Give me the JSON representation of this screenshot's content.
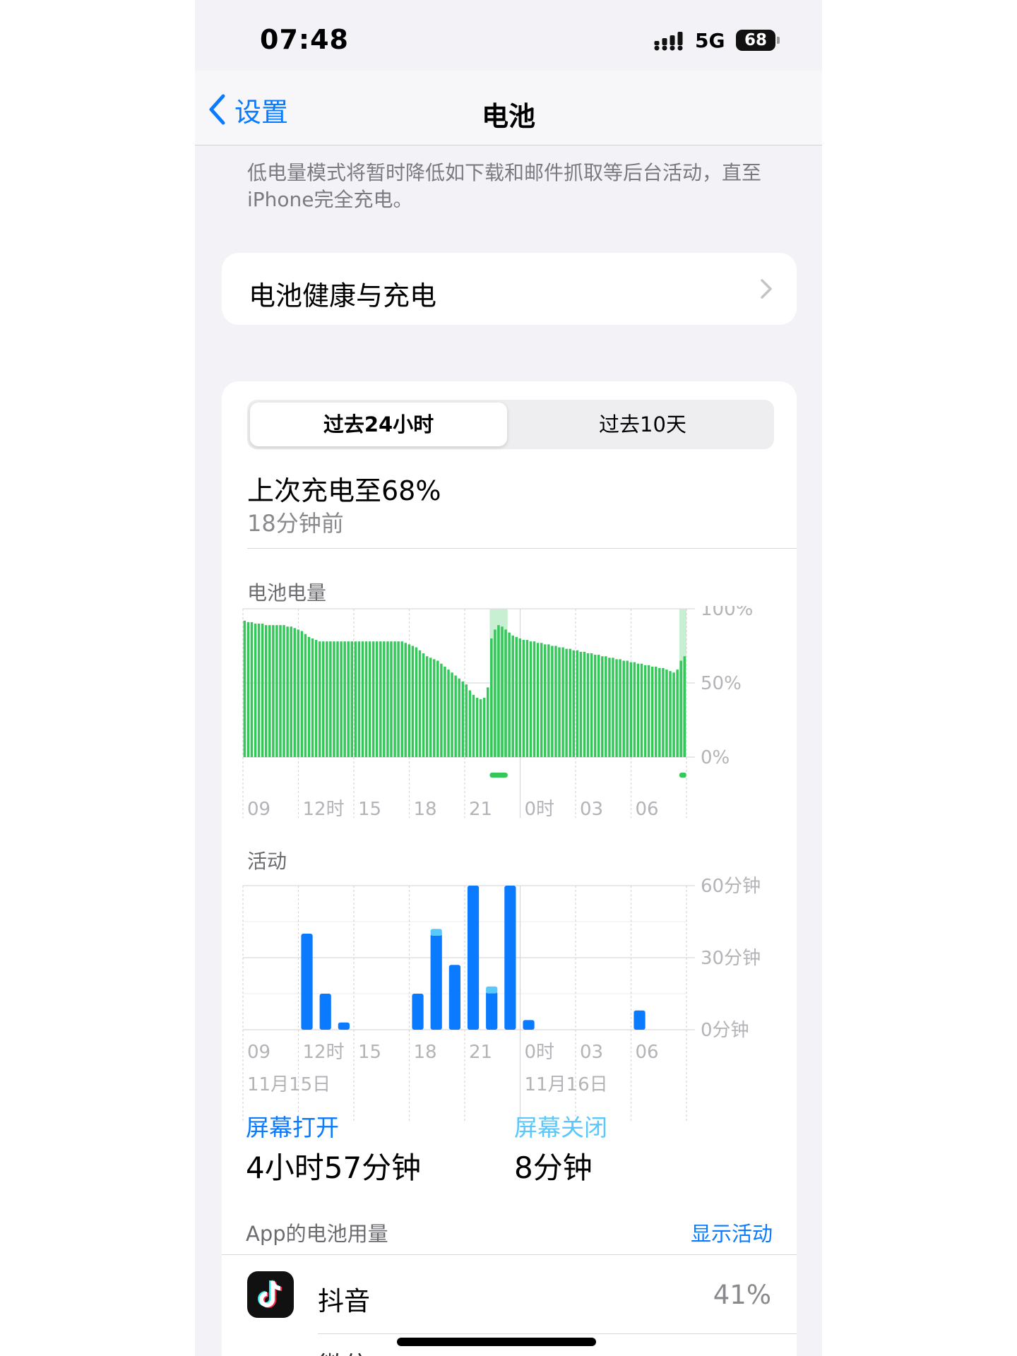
{
  "status_bar": {
    "time": "07:48",
    "network": "5G",
    "battery_level": "68"
  },
  "nav": {
    "back_label": "设置",
    "title": "电池"
  },
  "low_power_note": "低电量模式将暂时降低如下载和邮件抓取等后台活动，直至iPhone完全充电。",
  "health_row": {
    "label": "电池健康与充电"
  },
  "segmented": {
    "options": [
      "过去24小时",
      "过去10天"
    ],
    "selected": "过去24小时"
  },
  "last_charge": {
    "title": "上次充电至68%",
    "time": "18分钟前"
  },
  "colors": {
    "battery_bar": "#34c759",
    "charging_band": "#c9efd2",
    "screen_on": "#0a7aff",
    "screen_off": "#5ac8fa",
    "accent": "#0a7aff"
  },
  "chart_data": [
    {
      "type": "bar",
      "title": "电池电量",
      "x_tick_labels": [
        "09",
        "12时",
        "15",
        "18",
        "21",
        "0时",
        "03",
        "06"
      ],
      "y_tick_labels": [
        "100%",
        "50%",
        "0%"
      ],
      "ylim": [
        0,
        100
      ],
      "unit": "%",
      "values": [
        92,
        91,
        91,
        90,
        90,
        90,
        89,
        89,
        89,
        89,
        89,
        89,
        88,
        88,
        87,
        86,
        85,
        83,
        81,
        80,
        79,
        78,
        78,
        78,
        78,
        78,
        78,
        78,
        78,
        78,
        78,
        78,
        78,
        78,
        78,
        78,
        78,
        78,
        78,
        78,
        78,
        78,
        78,
        78,
        78,
        77,
        76,
        75,
        74,
        72,
        70,
        68,
        67,
        66,
        65,
        63,
        61,
        59,
        57,
        55,
        53,
        51,
        49,
        45,
        42,
        40,
        39,
        40,
        47,
        80,
        86,
        89,
        88,
        86,
        84,
        82,
        81,
        80,
        79,
        79,
        78,
        78,
        77,
        77,
        76,
        76,
        75,
        75,
        74,
        74,
        73,
        73,
        72,
        72,
        71,
        71,
        70,
        70,
        69,
        69,
        68,
        68,
        67,
        67,
        66,
        66,
        65,
        65,
        64,
        64,
        63,
        63,
        62,
        62,
        61,
        61,
        60,
        60,
        59,
        58,
        57,
        59,
        65,
        68
      ],
      "charging_periods": [
        [
          69,
          74
        ],
        [
          122,
          124
        ]
      ]
    },
    {
      "type": "bar",
      "title": "活动",
      "x_tick_labels": [
        "09",
        "12时",
        "15",
        "18",
        "21",
        "0时",
        "03",
        "06"
      ],
      "date_labels": [
        "11月15日",
        "11月16日"
      ],
      "y_tick_labels": [
        "60分钟",
        "30分钟",
        "0分钟"
      ],
      "ylim": [
        0,
        60
      ],
      "unit": "分钟",
      "categories": [
        "09",
        "10",
        "11",
        "12",
        "13",
        "14",
        "15",
        "16",
        "17",
        "18",
        "19",
        "20",
        "21",
        "22",
        "23",
        "00",
        "01",
        "02",
        "03",
        "04",
        "05",
        "06",
        "07"
      ],
      "series": [
        {
          "name": "屏幕打开",
          "values": [
            0,
            0,
            0,
            40,
            15,
            3,
            0,
            0,
            0,
            15,
            40,
            27,
            60,
            16,
            60,
            4,
            0,
            0,
            0,
            0,
            0,
            8,
            0
          ]
        },
        {
          "name": "屏幕关闭",
          "values": [
            0,
            0,
            0,
            0,
            0,
            0,
            0,
            0,
            0,
            0,
            2,
            0,
            0,
            2,
            0,
            0,
            0,
            0,
            0,
            0,
            0,
            0,
            0
          ]
        }
      ]
    }
  ],
  "usage": {
    "screen_on_label": "屏幕打开",
    "screen_on_value": "4小时57分钟",
    "screen_off_label": "屏幕关闭",
    "screen_off_value": "8分钟"
  },
  "app_usage": {
    "title": "App的电池用量",
    "show_activity": "显示活动",
    "apps": [
      {
        "name": "抖音",
        "percent": "41%",
        "icon": "douyin-icon"
      }
    ],
    "next_app_peek": "微信"
  }
}
